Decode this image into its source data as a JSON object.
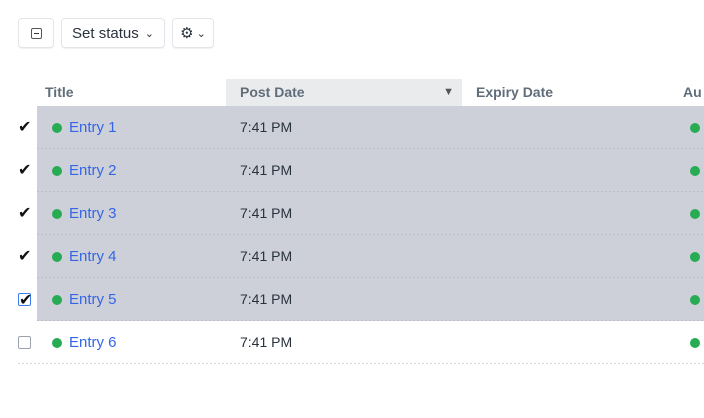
{
  "colors": {
    "status_enabled": "#27ab53",
    "selected_row": "#cdd0d8",
    "link": "#3366e6"
  },
  "toolbar": {
    "select_all_icon": "minus-square-icon",
    "set_status_label": "Set status",
    "set_status_chevron": "⌄",
    "gear_icon": "gear-icon",
    "gear_glyph": "⚙",
    "gear_chevron": "⌄"
  },
  "table": {
    "columns": [
      {
        "label": "Title"
      },
      {
        "label": "Post Date",
        "sorted": true,
        "sort_glyph": "▼"
      },
      {
        "label": "Expiry Date"
      },
      {
        "label": "Au"
      }
    ],
    "rows": [
      {
        "title": "Entry 1",
        "post_date": "7:41 PM",
        "selected": true,
        "check": "✔"
      },
      {
        "title": "Entry 2",
        "post_date": "7:41 PM",
        "selected": true,
        "check": "✔"
      },
      {
        "title": "Entry 3",
        "post_date": "7:41 PM",
        "selected": true,
        "check": "✔"
      },
      {
        "title": "Entry 4",
        "post_date": "7:41 PM",
        "selected": true,
        "check": "✔"
      },
      {
        "title": "Entry 5",
        "post_date": "7:41 PM",
        "selected": true,
        "check": "✔"
      },
      {
        "title": "Entry 6",
        "post_date": "7:41 PM",
        "selected": false,
        "check": ""
      }
    ]
  }
}
